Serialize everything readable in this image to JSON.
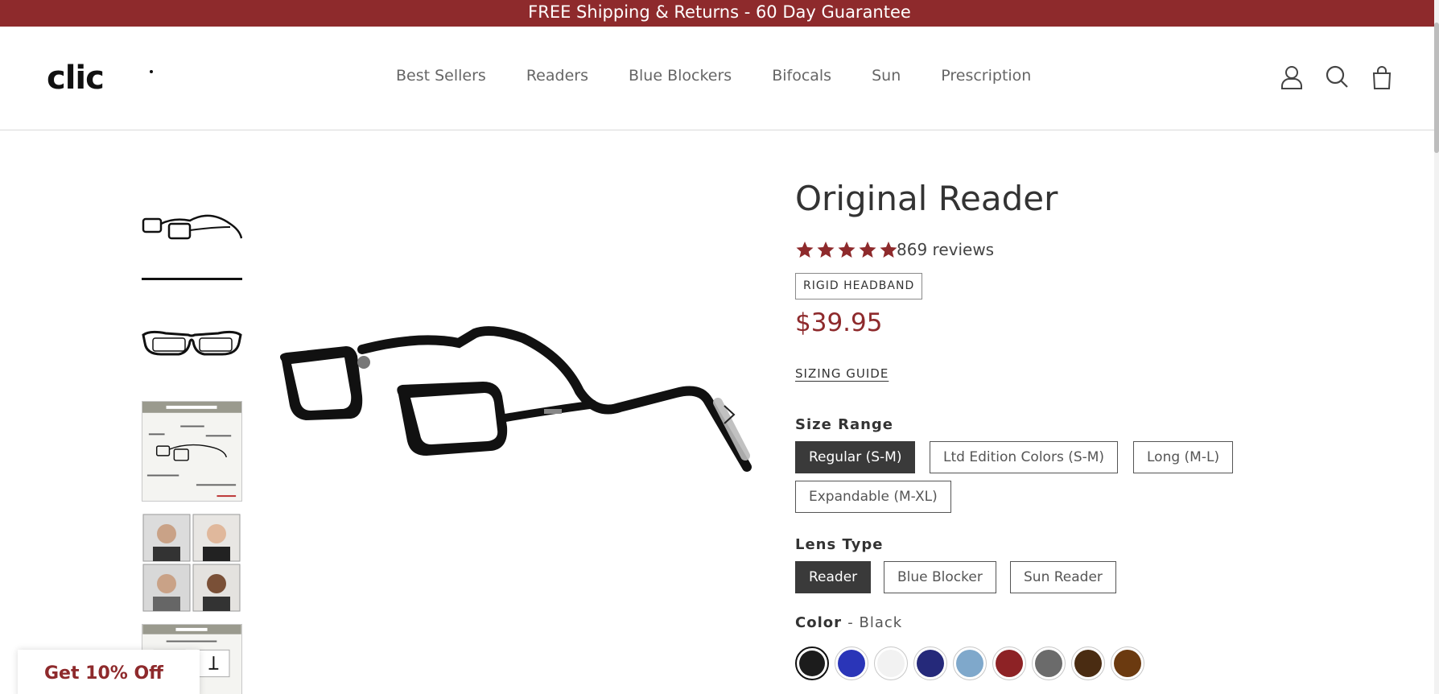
{
  "announcement": "FREE Shipping & Returns - 60 Day Guarantee",
  "brand": {
    "logo_text": "CLIC"
  },
  "nav": {
    "items": [
      "Best Sellers",
      "Readers",
      "Blue Blockers",
      "Bifocals",
      "Sun",
      "Prescription"
    ]
  },
  "header_icons": [
    "account-icon",
    "search-icon",
    "cart-icon"
  ],
  "product": {
    "title": "Original Reader",
    "rating": 5,
    "reviews": "869 reviews",
    "badge": "RIGID HEADBAND",
    "price": "$39.95",
    "sizing_guide": "SIZING GUIDE",
    "size_range": {
      "label": "Size Range",
      "options": [
        "Regular (S-M)",
        "Ltd Edition Colors (S-M)",
        "Long (M-L)",
        "Expandable (M-XL)"
      ],
      "selected": "Regular (S-M)"
    },
    "lens_type": {
      "label": "Lens Type",
      "options": [
        "Reader",
        "Blue Blocker",
        "Sun Reader"
      ],
      "selected": "Reader"
    },
    "color": {
      "label": "Color",
      "separator": "-",
      "selected": "Black",
      "swatches": [
        "#1c1c1c",
        "#2a35b8",
        "#f2f2f2",
        "#25297a",
        "#7fa8cb",
        "#8d2225",
        "#6b6b6b",
        "#4a2c12",
        "#6b3a10"
      ]
    }
  },
  "gallery": {
    "thumbnail_count": 5,
    "active_index": 0
  },
  "promo": {
    "label": "Get 10% Off"
  },
  "colors": {
    "brand_red": "#8e2a2c",
    "active_button": "#3a3a3a"
  }
}
